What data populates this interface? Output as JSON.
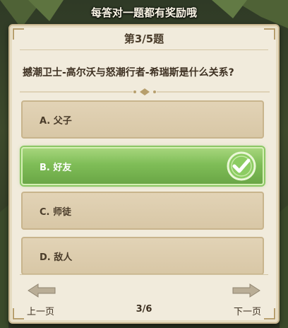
{
  "banner": {
    "text": "每答对一题都有奖励哦"
  },
  "quiz": {
    "number_label": "第3/5题",
    "question": "撼潮卫士-高尔沃与怒潮行者-希瑞斯是什么关系?",
    "options": [
      {
        "label": "A. 父子",
        "selected": false
      },
      {
        "label": "B. 好友",
        "selected": true
      },
      {
        "label": "C. 师徒",
        "selected": false
      },
      {
        "label": "D. 敌人",
        "selected": false
      }
    ]
  },
  "footer": {
    "prev_label": "上一页",
    "next_label": "下一页",
    "page_indicator": "3/6"
  },
  "colors": {
    "panel": "#f1ebdc",
    "option": "#d8c7a6",
    "selected_option": "#7fbd57",
    "text": "#4a3c2a"
  },
  "icons": {
    "check": "check-circle-icon",
    "prev": "arrow-left-icon",
    "next": "arrow-right-icon"
  }
}
